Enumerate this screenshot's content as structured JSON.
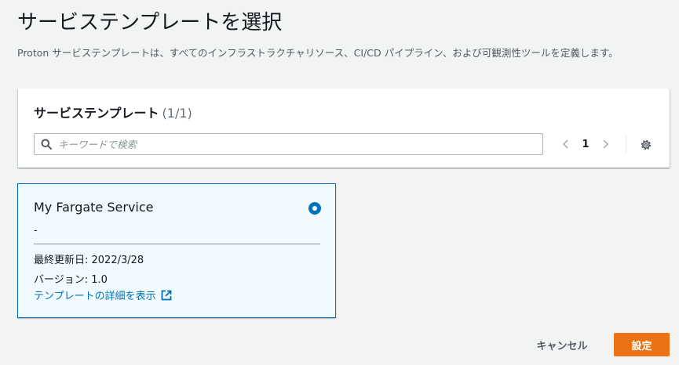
{
  "page": {
    "title": "サービステンプレートを選択",
    "description": "Proton サービステンプレートは、すべてのインフラストラクチャリソース、CI/CD パイプライン、および可観測性ツールを定義します。"
  },
  "panel": {
    "header": "サービステンプレート",
    "count": "(1/1)",
    "search_placeholder": "キーワードで検索",
    "search_icon": "search-icon",
    "page_number": "1",
    "settings_icon": "gear-icon"
  },
  "card": {
    "title": "My Fargate Service",
    "description": "-",
    "last_updated": "最終更新日: 2022/3/28",
    "version": "バージョン: 1.0",
    "link": "テンプレートの詳細を表示",
    "selected": true
  },
  "footer": {
    "cancel_label": "キャンセル",
    "submit_label": "設定"
  },
  "colors": {
    "accent": "#0073bb",
    "primary_button": "#ec7211",
    "background": "#f2f3f3"
  }
}
